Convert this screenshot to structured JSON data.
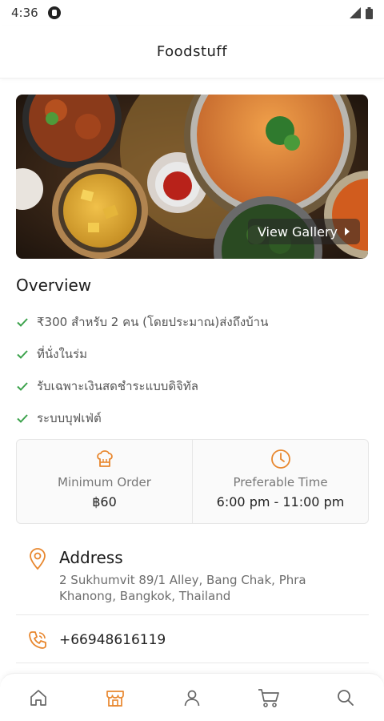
{
  "status_bar": {
    "time": "4:36"
  },
  "header": {
    "title": "Foodstuff"
  },
  "hero": {
    "gallery_label": "View Gallery"
  },
  "overview": {
    "title": "Overview",
    "features": [
      "₹300 สำหรับ 2 คน (โดยประมาณ)ส่งถึงบ้าน",
      "ที่นั่งในร่ม",
      "รับเฉพาะเงินสดชำระแบบดิจิทัล",
      "ระบบบุฟเฟ่ต์"
    ]
  },
  "info": {
    "min_order_label": "Minimum Order",
    "min_order_value": "฿60",
    "time_label": "Preferable Time",
    "time_value": "6:00 pm - 11:00 pm"
  },
  "address": {
    "title": "Address",
    "line1": "2 Sukhumvit 89/1 Alley, Bang Chak, Phra",
    "line2": "Khanong, Bangkok, Thailand"
  },
  "phone": {
    "number": "+66948616119"
  },
  "colors": {
    "accent": "#e8872e",
    "check": "#3aa14a"
  },
  "nav": {
    "items": [
      "home-icon",
      "store-icon",
      "profile-icon",
      "cart-icon",
      "search-icon"
    ],
    "active": "store-icon"
  }
}
